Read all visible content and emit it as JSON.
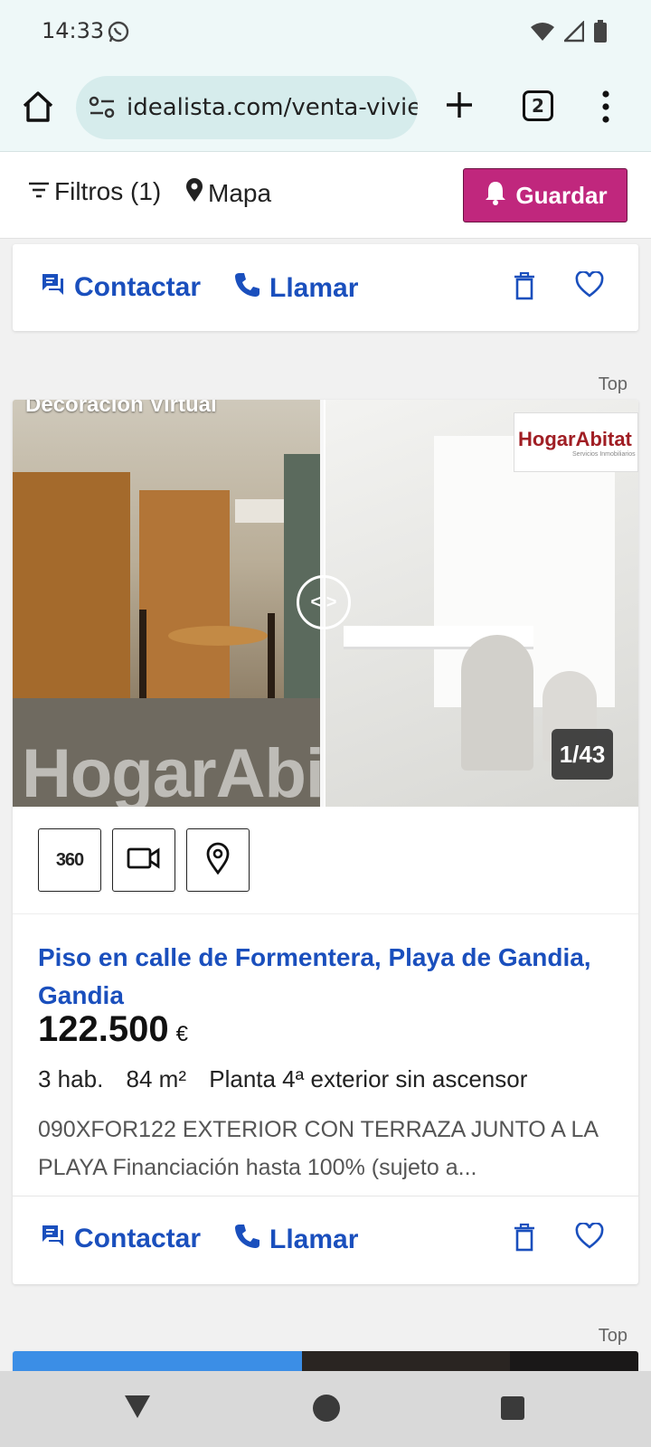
{
  "status_bar": {
    "time": "14:33"
  },
  "browser": {
    "url": "idealista.com/venta-vivie",
    "tab_count": "2"
  },
  "filter_bar": {
    "filters_label": "Filtros (1)",
    "map_label": "Mapa",
    "save_label": "Guardar"
  },
  "actions": {
    "contact_label": "Contactar",
    "call_label": "Llamar"
  },
  "top_label": "Top",
  "listing": {
    "photo_overlay": "Decoración Virtual",
    "watermark": "HogarAbi",
    "agency_logo": "HogarAbitat",
    "agency_logo_sub": "Servicios Inmobiliarios",
    "photo_counter": "1/43",
    "tour_label": "360",
    "title": "Piso en calle de Formentera, Playa de Gandia, Gandia",
    "price": "122.500",
    "currency": "€",
    "rooms": "3 hab.",
    "area": "84 m²",
    "floor": "Planta 4ª exterior sin ascensor",
    "description": "090XFOR122 EXTERIOR CON TERRAZA JUNTO A LA PLAYA Financiación hasta 100% (sujeto a..."
  },
  "colors": {
    "brand_blue": "#1a4fbd",
    "save_magenta": "#c0277d",
    "chrome_bg": "#eef8f8"
  },
  "icons": [
    "whatsapp-icon",
    "wifi-icon",
    "signal-icon",
    "battery-icon",
    "home-icon",
    "tune-icon",
    "plus-icon",
    "more-vert-icon",
    "filter-icon",
    "map-pin-icon",
    "bell-icon",
    "chat-icon",
    "phone-icon",
    "trash-icon",
    "heart-icon",
    "360-icon",
    "video-icon",
    "location-icon"
  ]
}
